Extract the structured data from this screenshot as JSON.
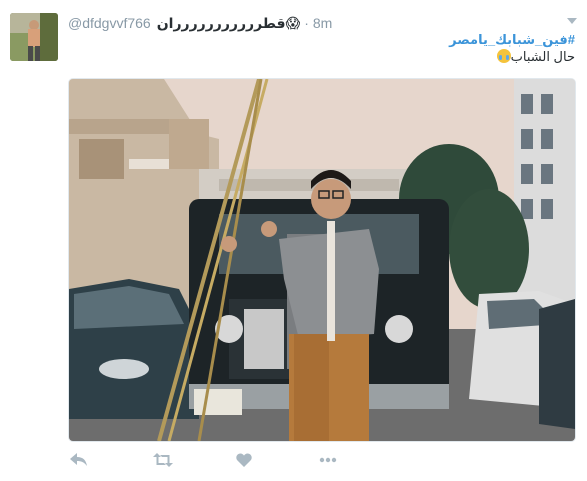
{
  "tweet": {
    "handle": "@dfdgvvf766",
    "display_name": "قطررررررررررران",
    "name_emoji": "😱",
    "separator": "·",
    "time": "8m",
    "hashtag": "#فين_شبابك_يامصر",
    "text": "حال الشباب",
    "text_emoji": "😂"
  },
  "actions": [
    "reply-icon",
    "retweet-icon",
    "like-icon",
    "more-icon"
  ],
  "colors": {
    "link": "#3b94d9",
    "muted": "#8899a6",
    "icon": "#aab8c2",
    "text": "#292f33"
  }
}
